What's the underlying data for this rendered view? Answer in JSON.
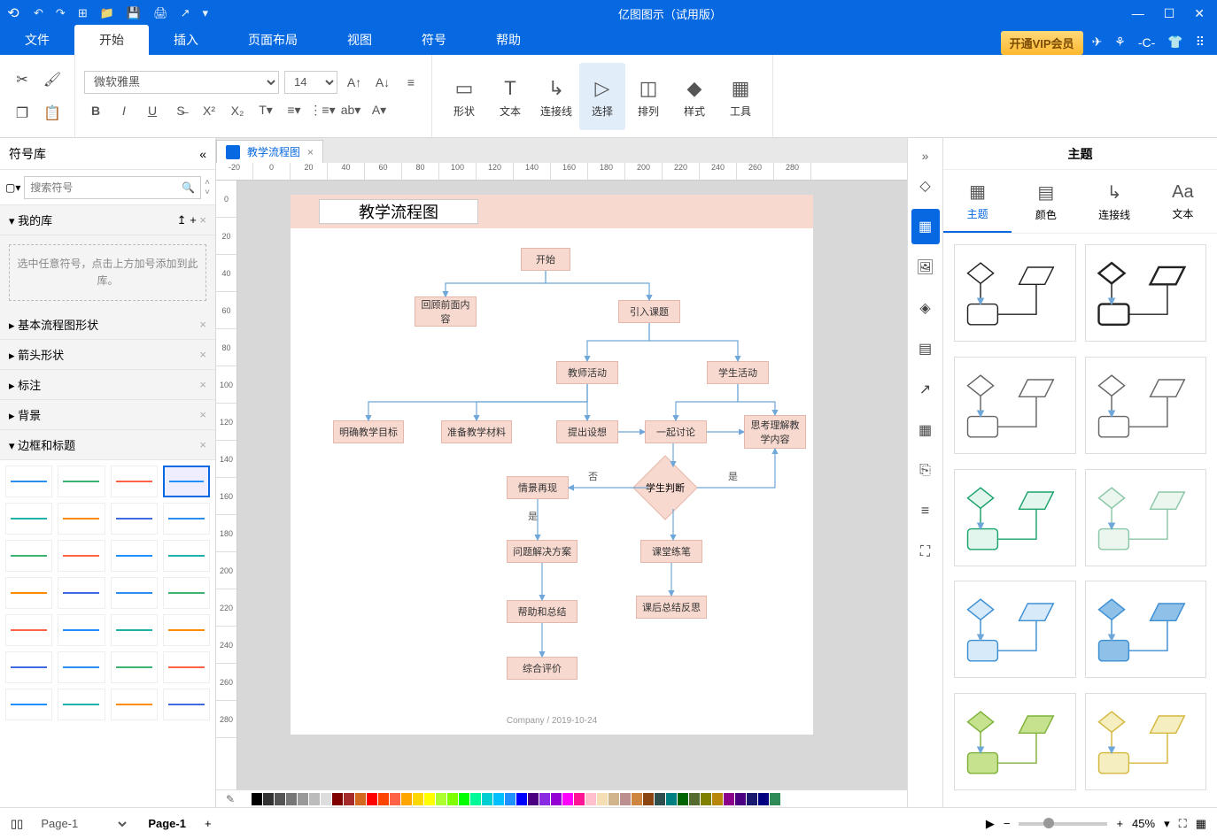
{
  "app": {
    "title": "亿图图示（试用版）"
  },
  "menu": {
    "tabs": [
      "文件",
      "开始",
      "插入",
      "页面布局",
      "视图",
      "符号",
      "帮助"
    ],
    "active": 1,
    "vip": "开通VIP会员"
  },
  "ribbon": {
    "font": "微软雅黑",
    "size": "14",
    "big": [
      {
        "label": "形状",
        "icon": "▭"
      },
      {
        "label": "文本",
        "icon": "T"
      },
      {
        "label": "连接线",
        "icon": "↳"
      },
      {
        "label": "选择",
        "icon": "▷",
        "sel": true
      },
      {
        "label": "排列",
        "icon": "◫"
      },
      {
        "label": "样式",
        "icon": "◆"
      },
      {
        "label": "工具",
        "icon": "▦"
      }
    ]
  },
  "left": {
    "title": "符号库",
    "search_ph": "搜索符号",
    "mylib": {
      "title": "我的库",
      "hint": "选中任意符号，点击上方加号添加到此库。"
    },
    "cats": [
      "基本流程图形状",
      "箭头形状",
      "标注",
      "背景"
    ],
    "expanded": "边框和标题"
  },
  "doc": {
    "tab": "教学流程图",
    "close": "×"
  },
  "ruler_h": [
    "-20",
    "0",
    "20",
    "40",
    "60",
    "80",
    "100",
    "120",
    "140",
    "160",
    "180",
    "200",
    "220",
    "240",
    "260",
    "280"
  ],
  "ruler_v": [
    "0",
    "20",
    "40",
    "60",
    "80",
    "100",
    "120",
    "140",
    "160",
    "180",
    "200",
    "220",
    "240",
    "260",
    "280"
  ],
  "flow": {
    "title": "教学流程图",
    "n": {
      "start": "开始",
      "review": "回顾前面内容",
      "intro": "引入课题",
      "teacher": "教师活动",
      "student": "学生活动",
      "goal": "明确教学目标",
      "material": "准备教学材料",
      "hypo": "提出设想",
      "discuss": "一起讨论",
      "think": "思考理解教学内容",
      "redo": "情景再现",
      "judge": "学生判断",
      "no": "否",
      "yes_l": "是",
      "yes_r": "是",
      "solve": "问题解决方案",
      "practice": "课堂练笔",
      "help": "帮助和总结",
      "summary": "课后总结反思",
      "eval": "综合评价"
    },
    "footer": "Company / 2019-10-24"
  },
  "right": {
    "title": "主题",
    "tabs": [
      {
        "l": "主题",
        "ic": "▦"
      },
      {
        "l": "颜色",
        "ic": "▤"
      },
      {
        "l": "连接线",
        "ic": "↳"
      },
      {
        "l": "文本",
        "ic": "Aa"
      }
    ],
    "themes": [
      {
        "stroke": "#222",
        "fill": "none"
      },
      {
        "stroke": "#222",
        "fill": "none",
        "w": 2.5
      },
      {
        "stroke": "#666",
        "fill": "none"
      },
      {
        "stroke": "#666",
        "fill": "none"
      },
      {
        "stroke": "#1aa36b",
        "fill": "#e3f6ee"
      },
      {
        "stroke": "#8bc6a7",
        "fill": "#eaf6ee"
      },
      {
        "stroke": "#3d8fd4",
        "fill": "#d7eaf9"
      },
      {
        "stroke": "#3d8fd4",
        "fill": "#8fc0e8"
      },
      {
        "stroke": "#7fb23a",
        "fill": "#c6e28f"
      },
      {
        "stroke": "#d4b83d",
        "fill": "#f4eec0"
      }
    ]
  },
  "colors": [
    "#fff",
    "#000",
    "#333",
    "#555",
    "#777",
    "#999",
    "#bbb",
    "#ddd",
    "#800000",
    "#a52a2a",
    "#d2691e",
    "#ff0000",
    "#ff4500",
    "#ff6347",
    "#ffa500",
    "#ffd700",
    "#ffff00",
    "#adff2f",
    "#7fff00",
    "#00ff00",
    "#00fa9a",
    "#00ced1",
    "#00bfff",
    "#1e90ff",
    "#0000ff",
    "#4b0082",
    "#8a2be2",
    "#9400d3",
    "#ff00ff",
    "#ff1493",
    "#ffc0cb",
    "#f5deb3",
    "#d2b48c",
    "#bc8f8f",
    "#cd853f",
    "#8b4513",
    "#2f4f4f",
    "#008080",
    "#006400",
    "#556b2f",
    "#808000",
    "#b8860b",
    "#8b008b",
    "#4b0082",
    "#191970",
    "#000080",
    "#2e8b57"
  ],
  "status": {
    "pg_sel": "Page-1",
    "pg_tab": "Page-1",
    "zoom": "45%"
  }
}
